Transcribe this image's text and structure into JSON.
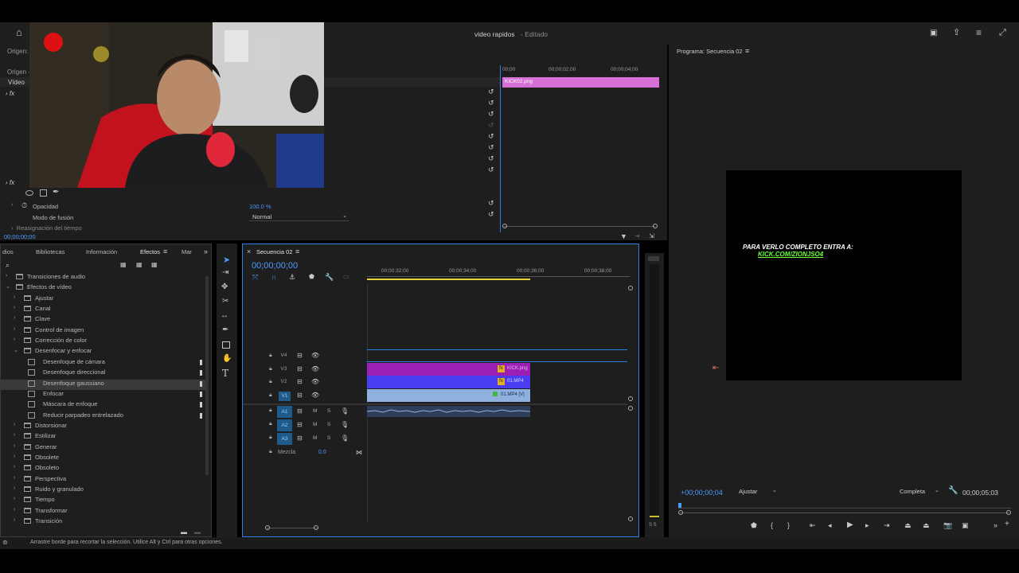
{
  "window": {
    "title": "video rapidos",
    "status": "Editado"
  },
  "top_icons": [
    "home-icon",
    "workspace-icon",
    "share-icon",
    "menu-icon",
    "fullscreen-icon"
  ],
  "effect_controls": {
    "origin_label": "Origen: (",
    "origin_sub": "Origen - ",
    "video_label": "Vídeo",
    "opacity_label": "Opacidad",
    "opacity_value": "100.0 %",
    "blend_label": "Modo de fusión",
    "blend_value": "Normal",
    "time_remap_label": "Reasignación del tiempo",
    "timecode": "00;00;00;00",
    "ruler": [
      "00;00",
      "00;00;02;00",
      "00;00;04;00"
    ],
    "clip_name": "KICK02.png"
  },
  "effects_panel": {
    "tabs": [
      "dios",
      "Bibliotecas",
      "Información",
      "Efectos",
      "Mar"
    ],
    "active_tab": "Efectos",
    "tree": [
      {
        "label": "Transiciones de audio",
        "level": 0,
        "type": "folder",
        "open": false
      },
      {
        "label": "Efectos de vídeo",
        "level": 0,
        "type": "folder",
        "open": true
      },
      {
        "label": "Ajustar",
        "level": 1,
        "type": "folder",
        "open": false
      },
      {
        "label": "Canal",
        "level": 1,
        "type": "folder",
        "open": false
      },
      {
        "label": "Clave",
        "level": 1,
        "type": "folder",
        "open": false
      },
      {
        "label": "Control de imagen",
        "level": 1,
        "type": "folder",
        "open": false
      },
      {
        "label": "Corrección de color",
        "level": 1,
        "type": "folder",
        "open": false
      },
      {
        "label": "Desenfocar y enfocar",
        "level": 1,
        "type": "folder",
        "open": true
      },
      {
        "label": "Desenfoque de cámara",
        "level": 2,
        "type": "effect"
      },
      {
        "label": "Desenfoque direccional",
        "level": 2,
        "type": "effect"
      },
      {
        "label": "Desenfoque gaussiano",
        "level": 2,
        "type": "effect",
        "selected": true
      },
      {
        "label": "Enfocar",
        "level": 2,
        "type": "effect"
      },
      {
        "label": "Máscara de enfoque",
        "level": 2,
        "type": "effect"
      },
      {
        "label": "Reducir parpadeo entrelazado",
        "level": 2,
        "type": "effect"
      },
      {
        "label": "Distorsionar",
        "level": 1,
        "type": "folder",
        "open": false
      },
      {
        "label": "Estilizar",
        "level": 1,
        "type": "folder",
        "open": false
      },
      {
        "label": "Generar",
        "level": 1,
        "type": "folder",
        "open": false
      },
      {
        "label": "Obsolete",
        "level": 1,
        "type": "folder",
        "open": false
      },
      {
        "label": "Obsoleto",
        "level": 1,
        "type": "folder",
        "open": false
      },
      {
        "label": "Perspectiva",
        "level": 1,
        "type": "folder",
        "open": false
      },
      {
        "label": "Ruido y granulado",
        "level": 1,
        "type": "folder",
        "open": false
      },
      {
        "label": "Tiempo",
        "level": 1,
        "type": "folder",
        "open": false
      },
      {
        "label": "Transformar",
        "level": 1,
        "type": "folder",
        "open": false
      },
      {
        "label": "Transición",
        "level": 1,
        "type": "folder",
        "open": false
      }
    ]
  },
  "timeline": {
    "tab": "Secuencia 02",
    "timecode": "00;00;00;00",
    "ruler": [
      "00;00;32;00",
      "00;00;34;00",
      "00;00;36;00",
      "00;00;38;00"
    ],
    "video_tracks": [
      "V4",
      "V3",
      "V2",
      "V1"
    ],
    "audio_tracks": [
      "A1",
      "A2",
      "A3"
    ],
    "mix_label": "Mezcla",
    "mix_value": "0.0",
    "mute": "M",
    "solo": "S",
    "clips": {
      "v3": "KICK.png",
      "v2": "01.MP4",
      "v1": "01.MP4 [V]"
    }
  },
  "program_monitor": {
    "title": "Programa: Secuencia 02",
    "overlay_line1": "PARA VERLO COMPLETO ENTRA A:",
    "overlay_line2": "KICK.COM/ZIONJSO4",
    "timecode": "+00;00;00;04",
    "fit": "Ajustar",
    "quality": "Completa",
    "duration": "00;00;05;03",
    "meter_label": "S S"
  },
  "status_bar": "Arrastre borde para recortar la selección. Utilice Alt y Ctrl para otras opciones.",
  "colors": {
    "accent_blue": "#4d9bff",
    "clip_pink": "#d670d6",
    "clip_magenta": "#9b1fb5",
    "clip_blue": "#4a3cf0",
    "clip_lightblue": "#8fb1e0",
    "overlay_green": "#6cff3c"
  }
}
